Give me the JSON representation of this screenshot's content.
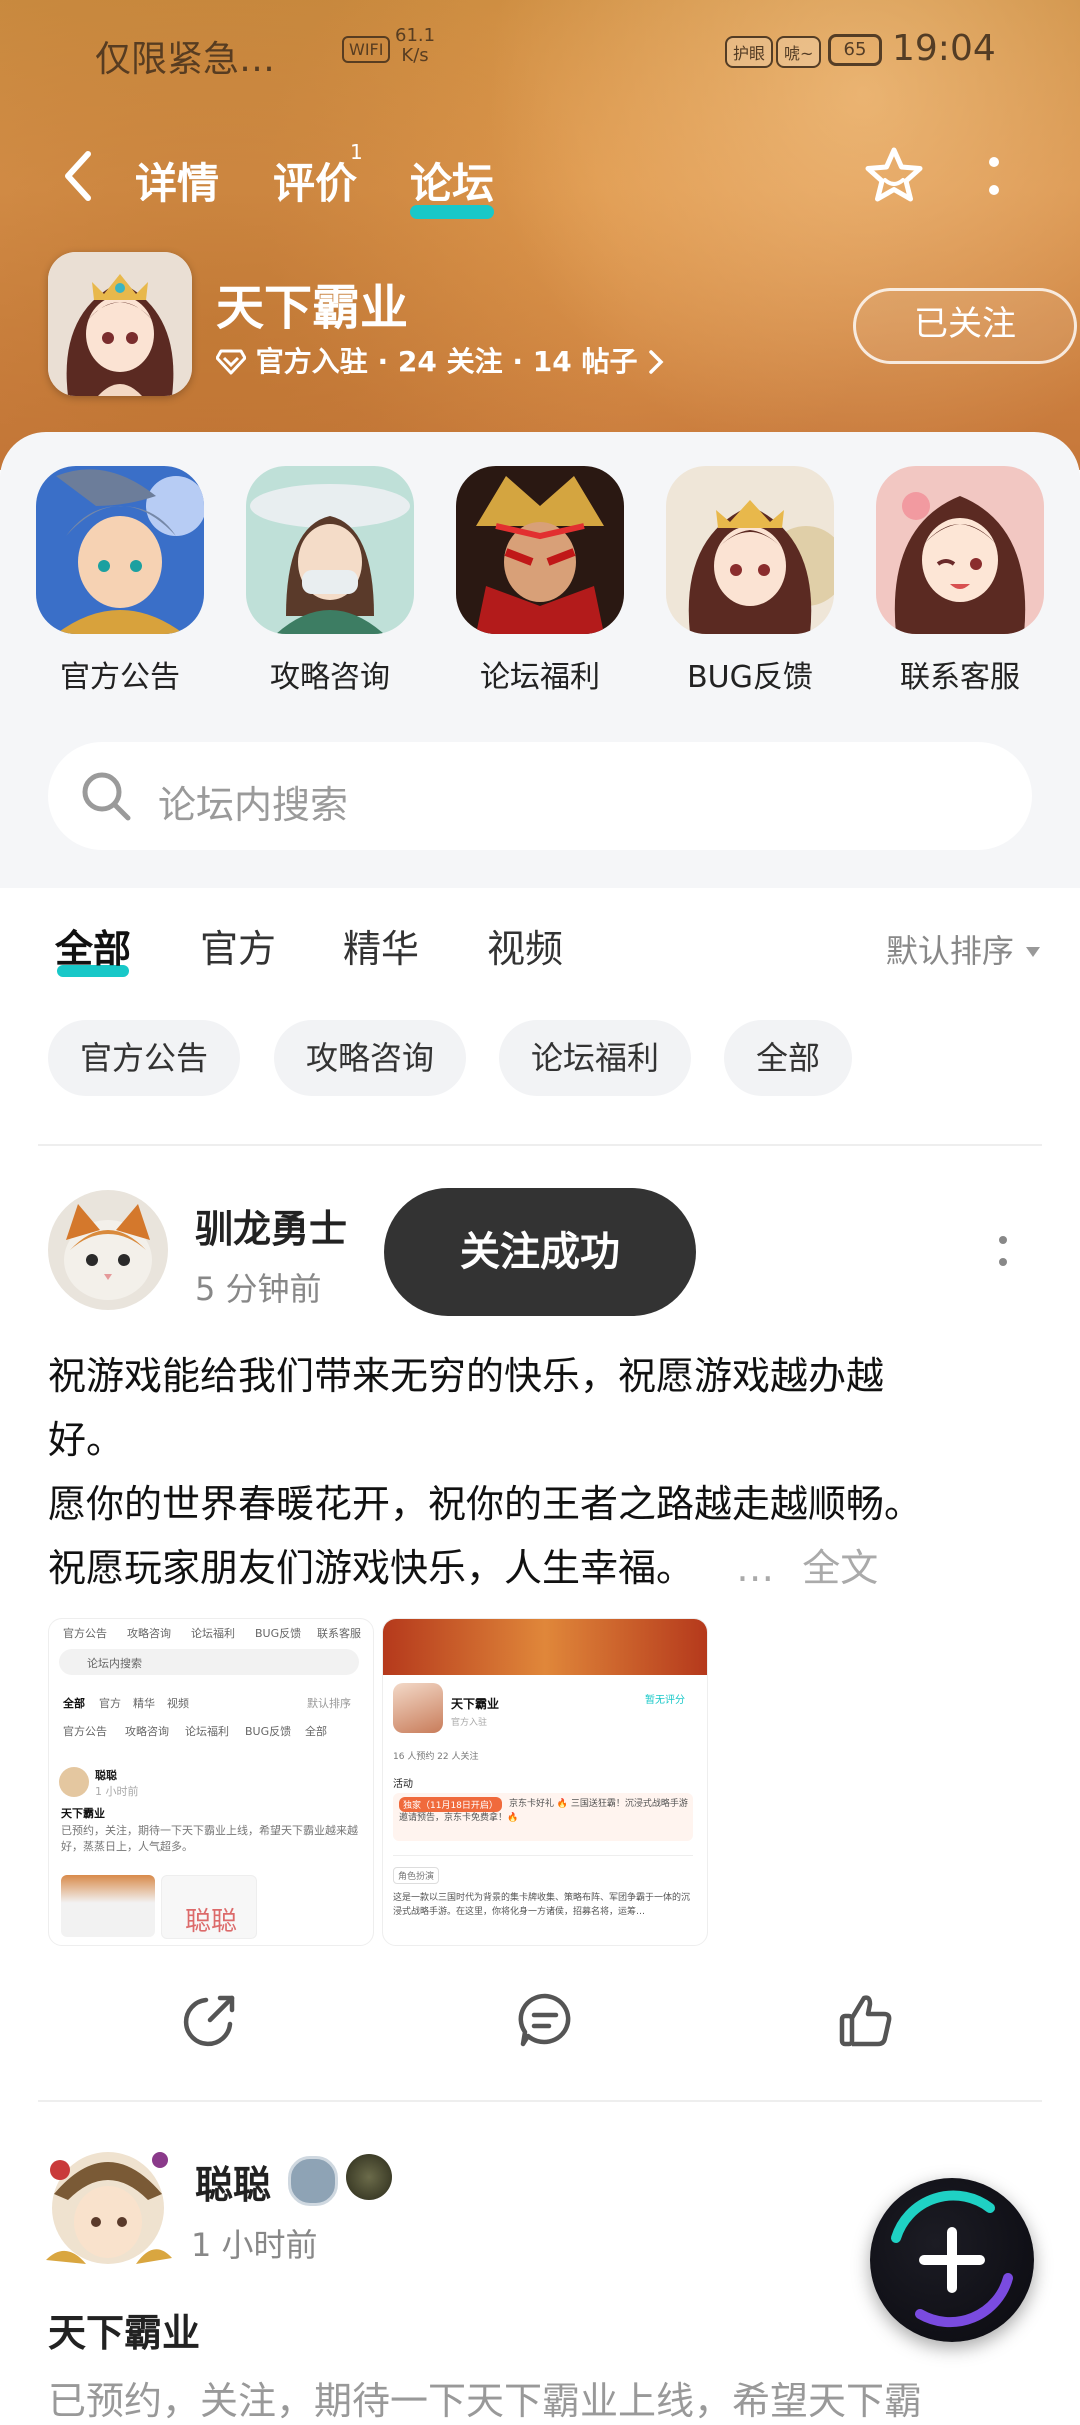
{
  "status_bar": {
    "left_text": "仅限紧急…",
    "wifi_label": "WIFI",
    "speed_value": "61.1",
    "speed_unit": "K/s",
    "pill_1": "护眼",
    "pill_2": "唬~",
    "battery": "65",
    "time": "19:04"
  },
  "nav": {
    "tabs": [
      {
        "label": "详情"
      },
      {
        "label": "评价"
      },
      {
        "label": "论坛"
      }
    ],
    "review_badge": "1",
    "active_tab": "论坛"
  },
  "game": {
    "title": "天下霸业",
    "meta": "官方入驻 · 24 关注 · 14 帖子",
    "follow_button": "已关注"
  },
  "categories": [
    {
      "label": "官方公告"
    },
    {
      "label": "攻略咨询"
    },
    {
      "label": "论坛福利"
    },
    {
      "label": "BUG反馈"
    },
    {
      "label": "联系客服"
    }
  ],
  "search": {
    "placeholder": "论坛内搜索"
  },
  "filter_tabs": [
    {
      "label": "全部"
    },
    {
      "label": "官方"
    },
    {
      "label": "精华"
    },
    {
      "label": "视频"
    }
  ],
  "sort_label": "默认排序",
  "chips": [
    {
      "label": "官方公告"
    },
    {
      "label": "攻略咨询"
    },
    {
      "label": "论坛福利"
    },
    {
      "label": "全部"
    }
  ],
  "post1": {
    "author": "驯龙勇士",
    "time": "5 分钟前",
    "lines": [
      "祝游戏能给我们带来无穷的快乐，祝愿游戏越办越",
      "好。",
      "愿你的世界春暖花开，祝你的王者之路越走越顺畅。",
      "祝愿玩家朋友们游戏快乐，人生幸福。"
    ],
    "ellipsis": "…",
    "full_text": "全文"
  },
  "toast": "关注成功",
  "post2": {
    "author": "聪聪",
    "time": "1 小时前",
    "title": "天下霸业",
    "preview": "已预约，关注，期待一下天下霸业上线，希望天下霸"
  },
  "thumb1": {
    "tabs": [
      "官方公告",
      "攻略咨询",
      "论坛福利",
      "BUG反馈",
      "联系客服"
    ],
    "search": "论坛内搜索",
    "filters": [
      "全部",
      "官方",
      "精华",
      "视频"
    ],
    "sort": "默认排序",
    "chips": [
      "官方公告",
      "攻略咨询",
      "论坛福利",
      "BUG反馈",
      "全部"
    ],
    "author": "聪聪",
    "time": "1 小时前",
    "title": "天下霸业",
    "text": "已预约，关注，期待一下天下霸业上线，希望天下霸业越来越好，蒸蒸日上，人气超多。",
    "watermark": "聪聪"
  },
  "thumb2": {
    "title": "天下霸业",
    "rating": "暂无评分",
    "badge": "官方入驻",
    "stats": "16 人预约   22 人关注",
    "activity": "活动",
    "promo_tag": "独家（11月18日开启）",
    "promo": "京东卡好礼 🔥 三国送狂霸！沉浸式战略手游邀请预告，京东卡免费拿！🔥",
    "section": "角色扮演",
    "desc": "这是一款以三国时代为背景的集卡牌收集、策略布阵、军团争霸于一体的沉浸式战略手游。在这里，你将化身一方诸侯，招募名将，运筹…"
  },
  "colors": {
    "accent": "#18c8c8",
    "banner": "#c98a3f",
    "toast_bg": "#333333"
  }
}
